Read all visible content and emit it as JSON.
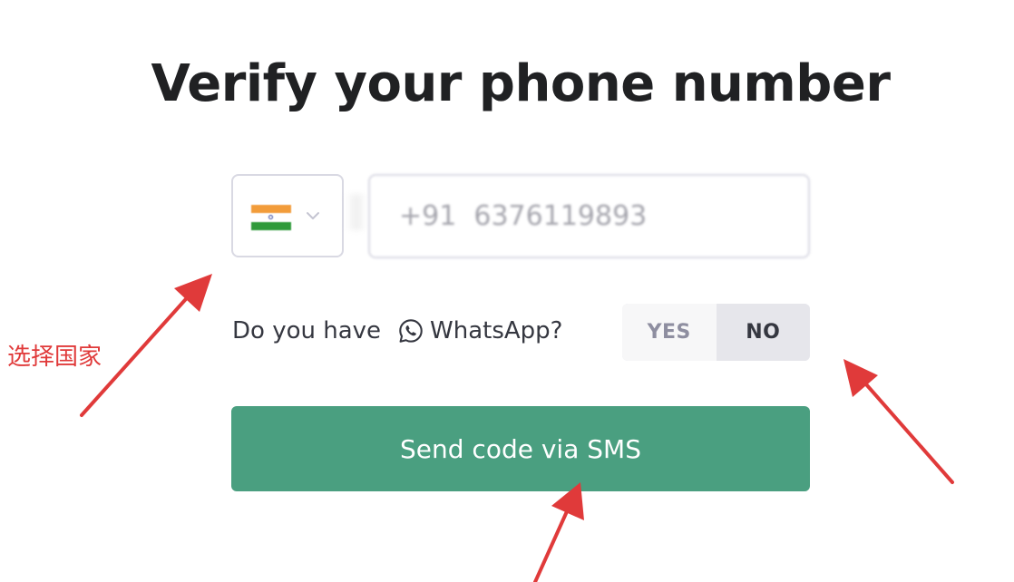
{
  "page": {
    "title": "Verify your phone number"
  },
  "phone": {
    "country_flag": "india-flag-icon",
    "flag_colors": [
      "#f29c3a",
      "#ffffff",
      "#2f9a3a",
      "#3a4aa0"
    ],
    "value": "+91  6376119893"
  },
  "whatsapp": {
    "question_prefix": "Do you have",
    "icon": "whatsapp-icon",
    "question_suffix": "WhatsApp?",
    "yes_label": "YES",
    "no_label": "NO",
    "selected": "NO"
  },
  "submit": {
    "label": "Send code via SMS",
    "color": "#4a9f80"
  },
  "annotations": {
    "label": "选择国家",
    "color": "#e03a3a"
  }
}
